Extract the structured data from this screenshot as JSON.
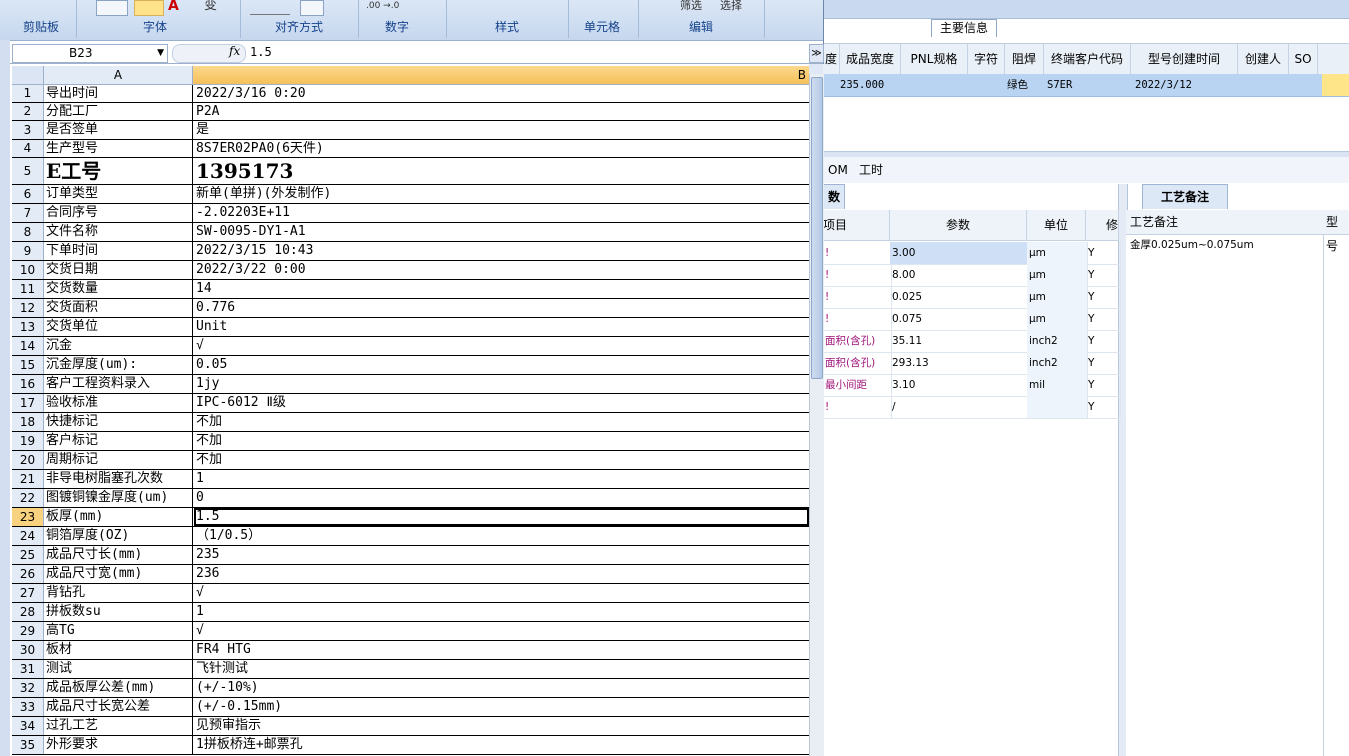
{
  "ribbon": {
    "groups": [
      "剪贴板",
      "字体",
      "对齐方式",
      "数字",
      "样式",
      "单元格",
      "编辑"
    ],
    "tools": {
      "filter": "筛选",
      "select": "选择"
    }
  },
  "namebox": "B23",
  "fx_label": "fx",
  "formula_value": "1.5",
  "columns": {
    "a": "A",
    "b": "B"
  },
  "rows": [
    {
      "n": "1",
      "a": "导出时间",
      "b": "2022/3/16 0:20"
    },
    {
      "n": "2",
      "a": "分配工厂",
      "b": "P2A"
    },
    {
      "n": "3",
      "a": "是否签单",
      "b": "是"
    },
    {
      "n": "4",
      "a": "生产型号",
      "b": "8S7ER02PA0(6天件)"
    },
    {
      "n": "5",
      "a": "E工号",
      "b": "1395173"
    },
    {
      "n": "6",
      "a": "订单类型",
      "b": "新单(单拼)(外发制作)"
    },
    {
      "n": "7",
      "a": "合同序号",
      "b": "-2.02203E+11"
    },
    {
      "n": "8",
      "a": "文件名称",
      "b": "SW-0095-DY1-A1"
    },
    {
      "n": "9",
      "a": "下单时间",
      "b": "2022/3/15 10:43"
    },
    {
      "n": "10",
      "a": "交货日期",
      "b": "2022/3/22 0:00"
    },
    {
      "n": "11",
      "a": "交货数量",
      "b": "14"
    },
    {
      "n": "12",
      "a": "交货面积",
      "b": "0.776"
    },
    {
      "n": "13",
      "a": "交货单位",
      "b": "Unit"
    },
    {
      "n": "14",
      "a": "沉金",
      "b": "√"
    },
    {
      "n": "15",
      "a": "沉金厚度(um):",
      "b": "0.05"
    },
    {
      "n": "16",
      "a": "客户工程资料录入",
      "b": "1jy"
    },
    {
      "n": "17",
      "a": "验收标准",
      "b": "IPC-6012 Ⅱ级"
    },
    {
      "n": "18",
      "a": "快捷标记",
      "b": "不加"
    },
    {
      "n": "19",
      "a": "客户标记",
      "b": "不加"
    },
    {
      "n": "20",
      "a": "周期标记",
      "b": "不加"
    },
    {
      "n": "21",
      "a": "非导电树脂塞孔次数",
      "b": "1"
    },
    {
      "n": "22",
      "a": "图镀铜镍金厚度(um)",
      "b": "0"
    },
    {
      "n": "23",
      "a": "板厚(mm)",
      "b": "1.5"
    },
    {
      "n": "24",
      "a": "铜箔厚度(OZ)",
      "b": "（1/0.5）"
    },
    {
      "n": "25",
      "a": "成品尺寸长(mm)",
      "b": "235"
    },
    {
      "n": "26",
      "a": "成品尺寸宽(mm)",
      "b": "236"
    },
    {
      "n": "27",
      "a": "背钻孔",
      "b": "√"
    },
    {
      "n": "28",
      "a": "拼板数su",
      "b": "1"
    },
    {
      "n": "29",
      "a": "高TG",
      "b": "√"
    },
    {
      "n": "30",
      "a": "板材",
      "b": "FR4 HTG"
    },
    {
      "n": "31",
      "a": "测试",
      "b": "飞针测试"
    },
    {
      "n": "32",
      "a": "成品板厚公差(mm)",
      "b": "(+/-10%)"
    },
    {
      "n": "33",
      "a": "成品尺寸长宽公差",
      "b": "(+/-0.15mm)"
    },
    {
      "n": "34",
      "a": "过孔工艺",
      "b": "见预审指示"
    },
    {
      "n": "35",
      "a": "外形要求",
      "b": "1拼板桥连+邮票孔"
    }
  ],
  "bg": {
    "main_info_tab": "主要信息",
    "headers": [
      "度",
      "成品宽度",
      "PNL规格",
      "字符",
      "阻焊",
      "终端客户代码",
      "型号创建时间",
      "创建人",
      "SO"
    ],
    "row": {
      "width": "235.000",
      "solder": "绿色",
      "code": "S7ER",
      "created": "2022/3/12"
    },
    "tabs": [
      "OM",
      "工时"
    ],
    "left_panel_tab": "数",
    "right_panel_tab": "工艺备注",
    "param_headers": [
      "项目",
      "参数",
      "单位",
      "修"
    ],
    "params": [
      {
        "item": "!",
        "value": "3.00",
        "unit": "μm",
        "flag": "Y"
      },
      {
        "item": "!",
        "value": "8.00",
        "unit": "μm",
        "flag": "Y"
      },
      {
        "item": "!",
        "value": "0.025",
        "unit": "μm",
        "flag": "Y"
      },
      {
        "item": "!",
        "value": "0.075",
        "unit": "μm",
        "flag": "Y"
      },
      {
        "item": "面积(含孔)",
        "value": "35.11",
        "unit": "inch2",
        "flag": "Y"
      },
      {
        "item": "面积(含孔)",
        "value": "293.13",
        "unit": "inch2",
        "flag": "Y"
      },
      {
        "item": "最小间距",
        "value": "3.10",
        "unit": "mil",
        "flag": "Y"
      },
      {
        "item": "!",
        "value": "/",
        "unit": "",
        "flag": "Y"
      }
    ],
    "notes_headers": [
      "工艺备注",
      "型号"
    ],
    "note_text": "金厚0.025um~0.075um"
  },
  "colors": {
    "accent": "#f6c05a",
    "ribbon": "#c6d7ee",
    "selected_row": "#b9d4f2"
  }
}
